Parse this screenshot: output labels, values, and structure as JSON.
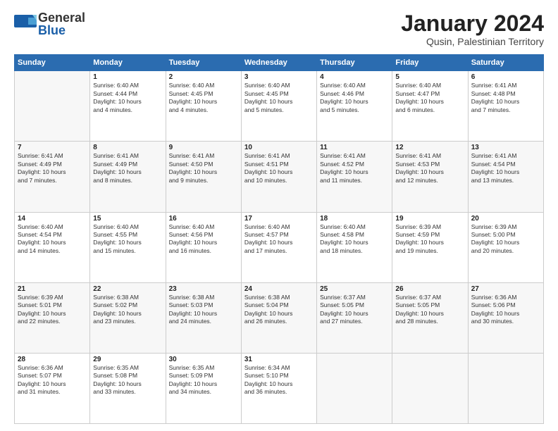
{
  "header": {
    "logo_general": "General",
    "logo_blue": "Blue",
    "title": "January 2024",
    "subtitle": "Qusin, Palestinian Territory"
  },
  "days_of_week": [
    "Sunday",
    "Monday",
    "Tuesday",
    "Wednesday",
    "Thursday",
    "Friday",
    "Saturday"
  ],
  "weeks": [
    [
      {
        "day": "",
        "sunrise": "",
        "sunset": "",
        "daylight": ""
      },
      {
        "day": "1",
        "sunrise": "Sunrise: 6:40 AM",
        "sunset": "Sunset: 4:44 PM",
        "daylight": "Daylight: 10 hours and 4 minutes."
      },
      {
        "day": "2",
        "sunrise": "Sunrise: 6:40 AM",
        "sunset": "Sunset: 4:45 PM",
        "daylight": "Daylight: 10 hours and 4 minutes."
      },
      {
        "day": "3",
        "sunrise": "Sunrise: 6:40 AM",
        "sunset": "Sunset: 4:45 PM",
        "daylight": "Daylight: 10 hours and 5 minutes."
      },
      {
        "day": "4",
        "sunrise": "Sunrise: 6:40 AM",
        "sunset": "Sunset: 4:46 PM",
        "daylight": "Daylight: 10 hours and 5 minutes."
      },
      {
        "day": "5",
        "sunrise": "Sunrise: 6:40 AM",
        "sunset": "Sunset: 4:47 PM",
        "daylight": "Daylight: 10 hours and 6 minutes."
      },
      {
        "day": "6",
        "sunrise": "Sunrise: 6:41 AM",
        "sunset": "Sunset: 4:48 PM",
        "daylight": "Daylight: 10 hours and 7 minutes."
      }
    ],
    [
      {
        "day": "7",
        "sunrise": "Sunrise: 6:41 AM",
        "sunset": "Sunset: 4:49 PM",
        "daylight": "Daylight: 10 hours and 7 minutes."
      },
      {
        "day": "8",
        "sunrise": "Sunrise: 6:41 AM",
        "sunset": "Sunset: 4:49 PM",
        "daylight": "Daylight: 10 hours and 8 minutes."
      },
      {
        "day": "9",
        "sunrise": "Sunrise: 6:41 AM",
        "sunset": "Sunset: 4:50 PM",
        "daylight": "Daylight: 10 hours and 9 minutes."
      },
      {
        "day": "10",
        "sunrise": "Sunrise: 6:41 AM",
        "sunset": "Sunset: 4:51 PM",
        "daylight": "Daylight: 10 hours and 10 minutes."
      },
      {
        "day": "11",
        "sunrise": "Sunrise: 6:41 AM",
        "sunset": "Sunset: 4:52 PM",
        "daylight": "Daylight: 10 hours and 11 minutes."
      },
      {
        "day": "12",
        "sunrise": "Sunrise: 6:41 AM",
        "sunset": "Sunset: 4:53 PM",
        "daylight": "Daylight: 10 hours and 12 minutes."
      },
      {
        "day": "13",
        "sunrise": "Sunrise: 6:41 AM",
        "sunset": "Sunset: 4:54 PM",
        "daylight": "Daylight: 10 hours and 13 minutes."
      }
    ],
    [
      {
        "day": "14",
        "sunrise": "Sunrise: 6:40 AM",
        "sunset": "Sunset: 4:54 PM",
        "daylight": "Daylight: 10 hours and 14 minutes."
      },
      {
        "day": "15",
        "sunrise": "Sunrise: 6:40 AM",
        "sunset": "Sunset: 4:55 PM",
        "daylight": "Daylight: 10 hours and 15 minutes."
      },
      {
        "day": "16",
        "sunrise": "Sunrise: 6:40 AM",
        "sunset": "Sunset: 4:56 PM",
        "daylight": "Daylight: 10 hours and 16 minutes."
      },
      {
        "day": "17",
        "sunrise": "Sunrise: 6:40 AM",
        "sunset": "Sunset: 4:57 PM",
        "daylight": "Daylight: 10 hours and 17 minutes."
      },
      {
        "day": "18",
        "sunrise": "Sunrise: 6:40 AM",
        "sunset": "Sunset: 4:58 PM",
        "daylight": "Daylight: 10 hours and 18 minutes."
      },
      {
        "day": "19",
        "sunrise": "Sunrise: 6:39 AM",
        "sunset": "Sunset: 4:59 PM",
        "daylight": "Daylight: 10 hours and 19 minutes."
      },
      {
        "day": "20",
        "sunrise": "Sunrise: 6:39 AM",
        "sunset": "Sunset: 5:00 PM",
        "daylight": "Daylight: 10 hours and 20 minutes."
      }
    ],
    [
      {
        "day": "21",
        "sunrise": "Sunrise: 6:39 AM",
        "sunset": "Sunset: 5:01 PM",
        "daylight": "Daylight: 10 hours and 22 minutes."
      },
      {
        "day": "22",
        "sunrise": "Sunrise: 6:38 AM",
        "sunset": "Sunset: 5:02 PM",
        "daylight": "Daylight: 10 hours and 23 minutes."
      },
      {
        "day": "23",
        "sunrise": "Sunrise: 6:38 AM",
        "sunset": "Sunset: 5:03 PM",
        "daylight": "Daylight: 10 hours and 24 minutes."
      },
      {
        "day": "24",
        "sunrise": "Sunrise: 6:38 AM",
        "sunset": "Sunset: 5:04 PM",
        "daylight": "Daylight: 10 hours and 26 minutes."
      },
      {
        "day": "25",
        "sunrise": "Sunrise: 6:37 AM",
        "sunset": "Sunset: 5:05 PM",
        "daylight": "Daylight: 10 hours and 27 minutes."
      },
      {
        "day": "26",
        "sunrise": "Sunrise: 6:37 AM",
        "sunset": "Sunset: 5:05 PM",
        "daylight": "Daylight: 10 hours and 28 minutes."
      },
      {
        "day": "27",
        "sunrise": "Sunrise: 6:36 AM",
        "sunset": "Sunset: 5:06 PM",
        "daylight": "Daylight: 10 hours and 30 minutes."
      }
    ],
    [
      {
        "day": "28",
        "sunrise": "Sunrise: 6:36 AM",
        "sunset": "Sunset: 5:07 PM",
        "daylight": "Daylight: 10 hours and 31 minutes."
      },
      {
        "day": "29",
        "sunrise": "Sunrise: 6:35 AM",
        "sunset": "Sunset: 5:08 PM",
        "daylight": "Daylight: 10 hours and 33 minutes."
      },
      {
        "day": "30",
        "sunrise": "Sunrise: 6:35 AM",
        "sunset": "Sunset: 5:09 PM",
        "daylight": "Daylight: 10 hours and 34 minutes."
      },
      {
        "day": "31",
        "sunrise": "Sunrise: 6:34 AM",
        "sunset": "Sunset: 5:10 PM",
        "daylight": "Daylight: 10 hours and 36 minutes."
      },
      {
        "day": "",
        "sunrise": "",
        "sunset": "",
        "daylight": ""
      },
      {
        "day": "",
        "sunrise": "",
        "sunset": "",
        "daylight": ""
      },
      {
        "day": "",
        "sunrise": "",
        "sunset": "",
        "daylight": ""
      }
    ]
  ]
}
